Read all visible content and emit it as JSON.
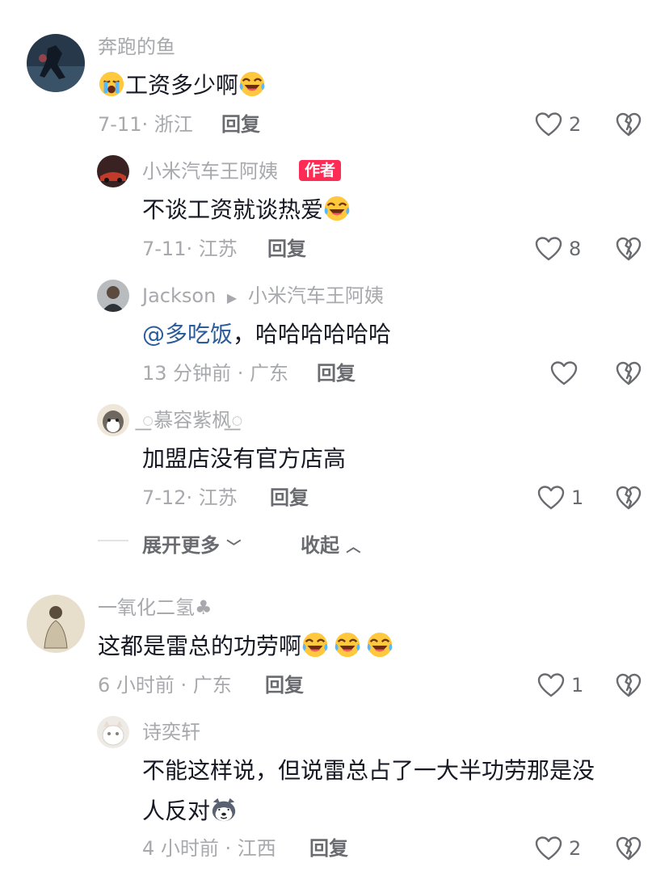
{
  "comments": [
    {
      "username": "奔跑的鱼",
      "text_before_emoji": "",
      "text": "工资多少啊",
      "meta": "7-11· 浙江",
      "reply_label": "回复",
      "likes": "2",
      "avatar_color": "#3a5268"
    },
    {
      "username": "小米汽车王阿姨",
      "badge": "作者",
      "text": "不谈工资就谈热爱",
      "meta": "7-11· 江苏",
      "reply_label": "回复",
      "likes": "8",
      "avatar_color": "#5a2a2a"
    },
    {
      "username": "Jackson",
      "reply_to": "小米汽车王阿姨",
      "mention": "@多吃饭",
      "text": "，哈哈哈哈哈哈",
      "meta": "13 分钟前 · 广东",
      "reply_label": "回复",
      "likes": "",
      "avatar_color": "#8a8f92"
    },
    {
      "username": "꯭慕容紫枫꯭",
      "text": "加盟店没有官方店高",
      "meta": "7-12· 江苏",
      "reply_label": "回复",
      "likes": "1",
      "avatar_color": "#c9b49a"
    }
  ],
  "expand_more": "展开更多",
  "collapse": "收起",
  "comments2": [
    {
      "username": "一氧化二氢♣",
      "text": "这都是雷总的功劳啊",
      "meta": "6 小时前 · 广东",
      "reply_label": "回复",
      "likes": "1",
      "avatar_color": "#d9cfb6"
    },
    {
      "username": "诗奕轩",
      "text_line1": "不能这样说，但说雷总占了一大半功劳那是没",
      "text_line2": "人反对",
      "meta": "4 小时前 · 江西",
      "reply_label": "回复",
      "likes": "2",
      "avatar_color": "#e6e0dc"
    }
  ],
  "accent_badge_color": "#fe2c55",
  "mention_color": "#2b5b9a"
}
